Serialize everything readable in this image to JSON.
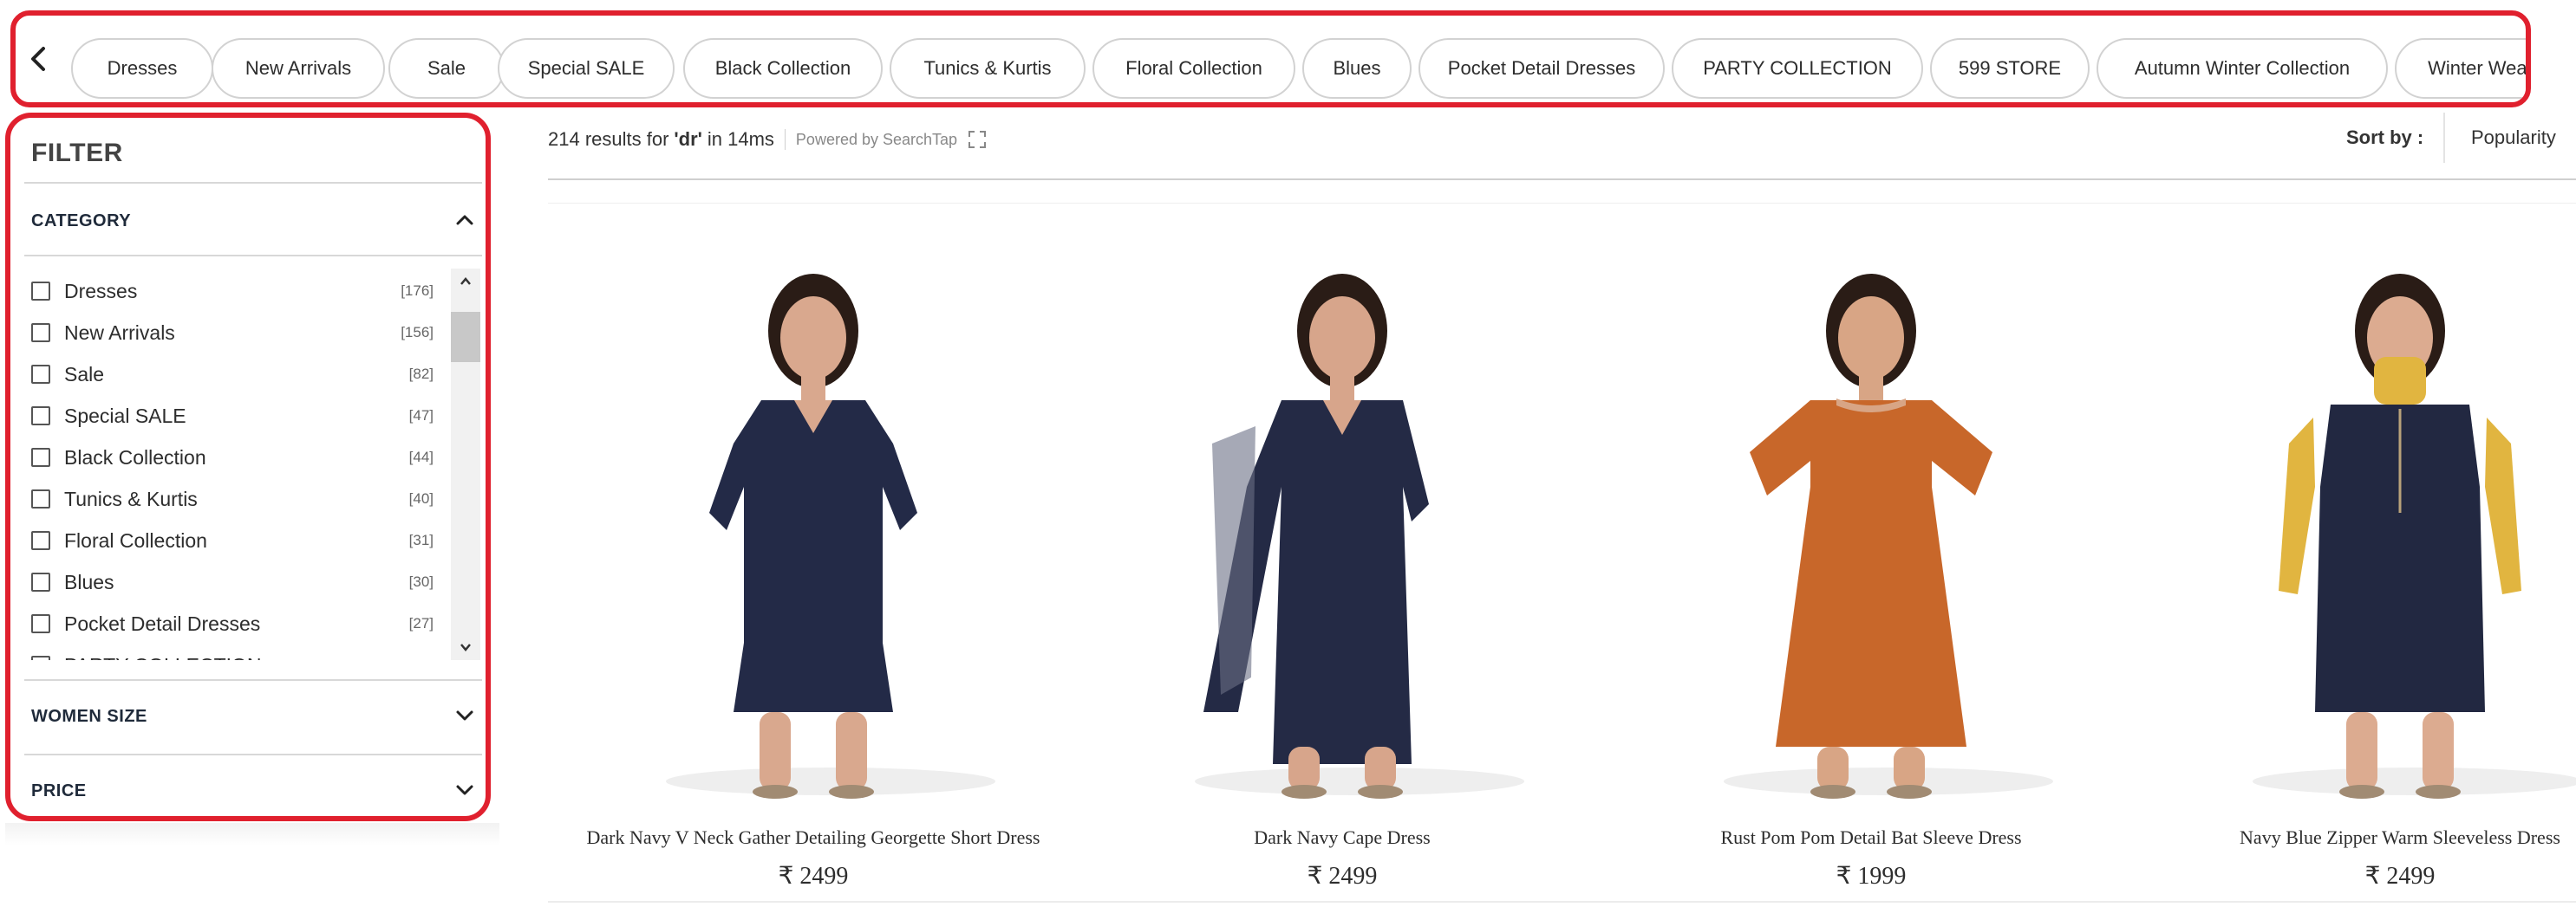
{
  "chips": {
    "items": [
      "Dresses",
      "New Arrivals",
      "Sale",
      "Special SALE",
      "Black Collection",
      "Tunics & Kurtis",
      "Floral Collection",
      "Blues",
      "Pocket Detail Dresses",
      "PARTY COLLECTION",
      "599 STORE",
      "Autumn Winter Collection",
      "Winter Wear"
    ]
  },
  "filter": {
    "title": "FILTER",
    "category": {
      "heading": "CATEGORY",
      "items": [
        {
          "label": "Dresses",
          "count": "[176]"
        },
        {
          "label": "New Arrivals",
          "count": "[156]"
        },
        {
          "label": "Sale",
          "count": "[82]"
        },
        {
          "label": "Special SALE",
          "count": "[47]"
        },
        {
          "label": "Black Collection",
          "count": "[44]"
        },
        {
          "label": "Tunics & Kurtis",
          "count": "[40]"
        },
        {
          "label": "Floral Collection",
          "count": "[31]"
        },
        {
          "label": "Blues",
          "count": "[30]"
        },
        {
          "label": "Pocket Detail Dresses",
          "count": "[27]"
        },
        {
          "label": "PARTY COLLECTION",
          "count": ""
        }
      ]
    },
    "women_size": {
      "heading": "WOMEN SIZE"
    },
    "price": {
      "heading": "PRICE"
    }
  },
  "results": {
    "count_prefix": "214 results for",
    "query": "'dr'",
    "time_text": "in 14ms",
    "powered_by": "Powered by SearchTap",
    "sort_label": "Sort by :",
    "sort_value": "Popularity"
  },
  "products": [
    {
      "name": "Dark Navy V Neck Gather Detailing Georgette Short Dress",
      "price": "₹ 2499",
      "dress_color": "#232a47",
      "skin": "#d9a88e",
      "style": "short"
    },
    {
      "name": "Dark Navy Cape Dress",
      "price": "₹ 2499",
      "dress_color": "#242a45",
      "skin": "#d7a58b",
      "style": "long"
    },
    {
      "name": "Rust Pom Pom Detail Bat Sleeve Dress",
      "price": "₹ 1999",
      "dress_color": "#c8672a",
      "skin": "#d8a585",
      "style": "midi"
    },
    {
      "name": "Navy Blue Zipper Warm Sleeveless Dress",
      "price": "₹ 2499",
      "dress_color": "#222841",
      "skin": "#dcab90",
      "style": "sleeveless",
      "accent": "#e1b540"
    }
  ],
  "colors": {
    "accent_red": "#e0202e",
    "chip_border": "#d2d2d2"
  }
}
